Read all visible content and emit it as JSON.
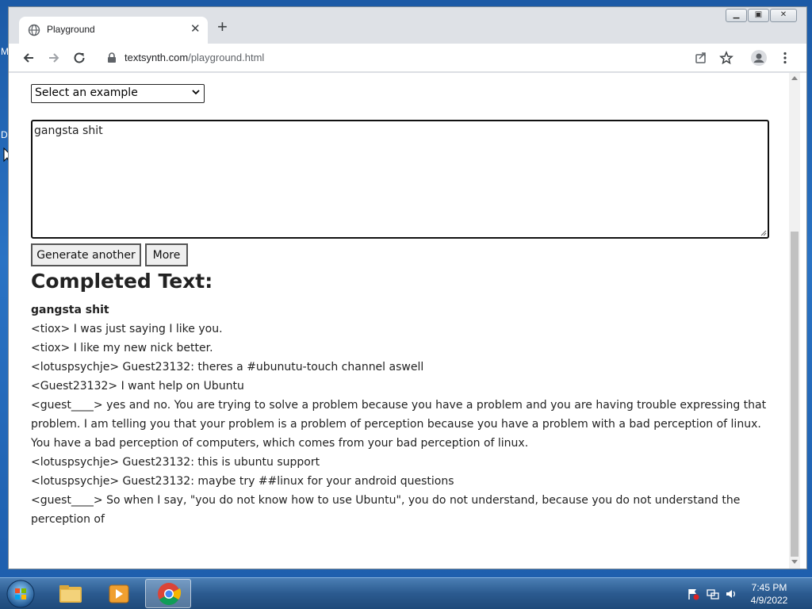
{
  "browser": {
    "tab_title": "Playground",
    "url_domain": "textsynth.com",
    "url_path": "/playground.html"
  },
  "page": {
    "example_select": "Select an example",
    "prompt_text": "gangsta shit",
    "generate_button": "Generate another",
    "more_button": "More",
    "completed_title": "Completed Text:",
    "output_prompt": "gangsta shit",
    "output_lines": [
      "<tiox> I was just saying I like you.",
      "<tiox> I like my new nick better.",
      "<lotuspsychje> Guest23132: theres a #ubunutu-touch channel aswell",
      "<Guest23132> I want help on Ubuntu",
      "<guest____> yes and no. You are trying to solve a problem because you have a problem and you are having trouble expressing that problem. I am telling you that your problem is a problem of perception because you have a problem with a bad perception of linux. You have a bad perception of computers, which comes from your bad perception of linux.",
      "<lotuspsychje> Guest23132: this is ubuntu support",
      "<lotuspsychje> Guest23132: maybe try ##linux for your android questions",
      "<guest____> So when I say, \"you do not know how to use Ubuntu\", you do not understand, because you do not understand the perception of"
    ]
  },
  "desktop": {
    "icon_letters": [
      "M",
      "D"
    ]
  },
  "taskbar": {
    "time": "7:45 PM",
    "date": "4/9/2022"
  },
  "icons": {
    "tab_favicon": "globe-icon",
    "tab_close": "close-icon",
    "new_tab": "plus-icon",
    "back": "arrow-left-icon",
    "forward": "arrow-right-icon",
    "reload": "reload-icon",
    "lock": "lock-icon",
    "share": "share-icon",
    "bookmark": "star-icon",
    "profile": "person-icon",
    "menu": "kebab-menu-icon"
  }
}
